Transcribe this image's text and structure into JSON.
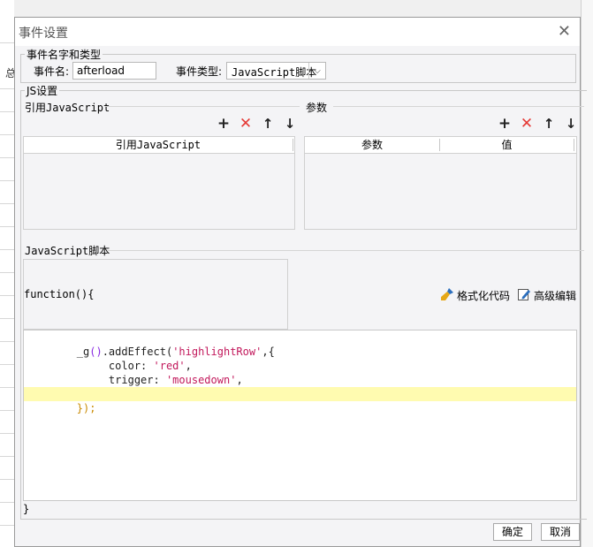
{
  "background": {
    "glyph": "总"
  },
  "dialog": {
    "title": "事件设置",
    "close_icon": "✕",
    "event_group": {
      "legend": "事件名字和类型",
      "name_label": "事件名:",
      "name_value": "afterload",
      "type_label": "事件类型:",
      "type_value": "JavaScript脚本"
    },
    "js_group": {
      "legend": "JS设置",
      "ref_section": {
        "title": "引用JavaScript",
        "column": "引用JavaScript"
      },
      "param_section": {
        "title": "参数",
        "columns": [
          "参数",
          "值"
        ]
      },
      "toolbar": {
        "add": "+",
        "remove": "✕",
        "up": "↑",
        "down": "↓"
      },
      "script_section": {
        "title": "JavaScript脚本",
        "function_header": "function(){",
        "format_label": "格式化代码",
        "advanced_label": "高级编辑",
        "closing_brace": "}"
      }
    },
    "code_lines": [
      {
        "prefix": "_g",
        "paren": "()",
        "mid": ".addEffect(",
        "str": "'highlightRow'",
        "tail": ",{"
      },
      {
        "prefix": "     color: ",
        "paren": "",
        "mid": "",
        "str": "'red'",
        "tail": ","
      },
      {
        "prefix": "     trigger: ",
        "paren": "",
        "mid": "",
        "str": "'mousedown'",
        "tail": ","
      },
      {
        "prefix": "",
        "paren": "",
        "mid": "",
        "str": "",
        "tail": ""
      },
      {
        "prefix": "",
        "paren": "",
        "mid": "",
        "str": "",
        "tail": "});"
      }
    ],
    "buttons": {
      "ok": "确定",
      "cancel": "取消"
    }
  }
}
